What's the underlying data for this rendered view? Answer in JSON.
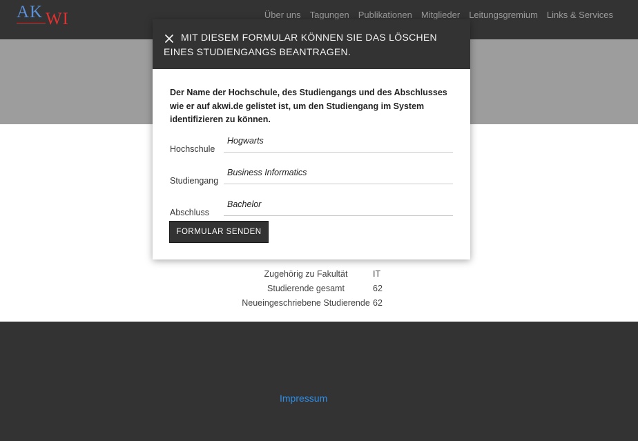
{
  "header": {
    "logo_text_ak": "AK",
    "logo_text_wi": "WI",
    "nav": [
      "Über uns",
      "Tagungen",
      "Publikationen",
      "Mitglieder",
      "Leitungsgremium",
      "Links & Services"
    ]
  },
  "program_info": [
    {
      "label": "Zugehörig zu Fakultät",
      "value": "IT"
    },
    {
      "label": "Studierende gesamt",
      "value": "62"
    },
    {
      "label": "Neueingeschriebene Studierende",
      "value": "62"
    }
  ],
  "footer": {
    "impressum": "Impressum"
  },
  "modal": {
    "title": "MIT DIESEM FORMULAR KÖNNEN SIE DAS LÖSCHEN EINES STUDIENGANGS BEANTRAGEN.",
    "description": "Der Name der Hochschule, des Studiengangs und des Abschlusses wie er auf akwi.de gelistet ist, um den Studiengang im System identifizieren zu können.",
    "fields": [
      {
        "label": "Hochschule",
        "value": "Hogwarts"
      },
      {
        "label": "Studiengang",
        "value": "Business Informatics"
      },
      {
        "label": "Abschluss",
        "value": "Bachelor"
      }
    ],
    "submit_label": "FORMULAR SENDEN"
  },
  "colors": {
    "header_bg": "#333333",
    "hero_bg": "#9d9d9d",
    "link": "#2e8ee8",
    "logo_blue": "#5b8fd6",
    "logo_red": "#e0312f"
  }
}
